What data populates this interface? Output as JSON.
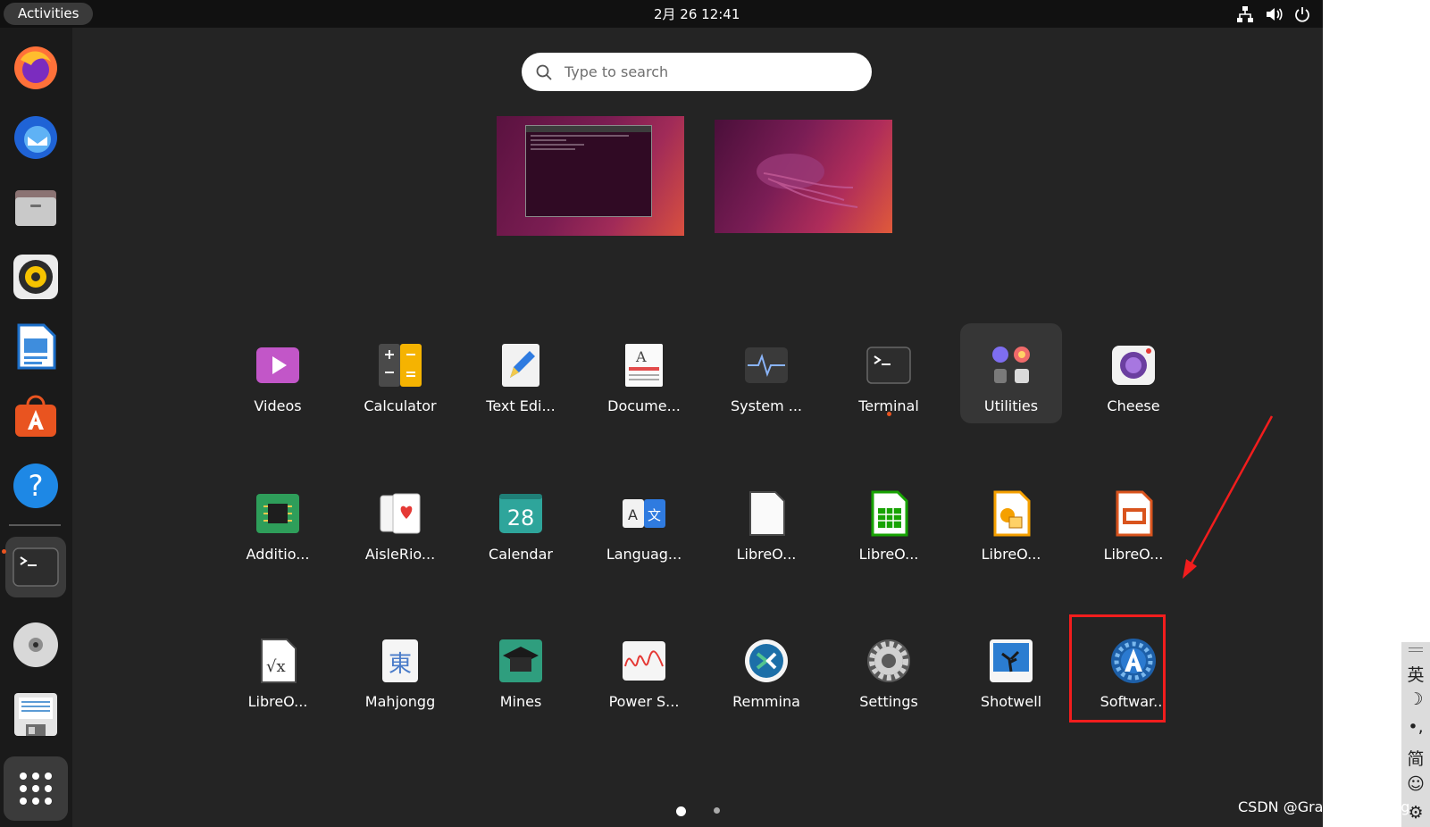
{
  "topbar": {
    "activities_label": "Activities",
    "clock": "2月 26  12:41",
    "tray_icons": [
      "network-icon",
      "volume-icon",
      "power-icon"
    ]
  },
  "dock": {
    "items": [
      {
        "name": "firefox-icon"
      },
      {
        "name": "thunderbird-icon"
      },
      {
        "name": "files-icon"
      },
      {
        "name": "rhythmbox-icon"
      },
      {
        "name": "libreoffice-writer-icon"
      },
      {
        "name": "ubuntu-software-icon"
      },
      {
        "name": "help-icon"
      },
      {
        "name": "terminal-icon",
        "running": true
      },
      {
        "name": "disc-icon"
      },
      {
        "name": "save-floppy-icon"
      },
      {
        "name": "show-apps-icon"
      }
    ]
  },
  "search": {
    "placeholder": "Type to search"
  },
  "apps": [
    {
      "label": "Videos",
      "icon": "videos-icon"
    },
    {
      "label": "Calculator",
      "icon": "calculator-icon"
    },
    {
      "label": "Text Edi...",
      "icon": "text-editor-icon"
    },
    {
      "label": "Docume...",
      "icon": "document-viewer-icon"
    },
    {
      "label": "System ...",
      "icon": "system-monitor-icon"
    },
    {
      "label": "Terminal",
      "icon": "terminal-icon",
      "running": true
    },
    {
      "label": "Utilities",
      "icon": "utilities-folder-icon",
      "selected": true
    },
    {
      "label": "Cheese",
      "icon": "cheese-icon"
    },
    {
      "label": "Additio...",
      "icon": "additional-drivers-icon"
    },
    {
      "label": "AisleRio...",
      "icon": "aisleriot-icon"
    },
    {
      "label": "Calendar",
      "icon": "calendar-icon",
      "day": "28"
    },
    {
      "label": "Languag...",
      "icon": "language-support-icon"
    },
    {
      "label": "LibreO...",
      "icon": "libreoffice-icon"
    },
    {
      "label": "LibreO...",
      "icon": "libreoffice-calc-icon"
    },
    {
      "label": "LibreO...",
      "icon": "libreoffice-draw-icon"
    },
    {
      "label": "LibreO...",
      "icon": "libreoffice-impress-icon"
    },
    {
      "label": "LibreO...",
      "icon": "libreoffice-math-icon"
    },
    {
      "label": "Mahjongg",
      "icon": "mahjongg-icon",
      "glyph": "東"
    },
    {
      "label": "Mines",
      "icon": "mines-icon"
    },
    {
      "label": "Power S...",
      "icon": "power-statistics-icon"
    },
    {
      "label": "Remmina",
      "icon": "remmina-icon"
    },
    {
      "label": "Settings",
      "icon": "settings-gear-icon"
    },
    {
      "label": "Shotwell",
      "icon": "shotwell-icon"
    },
    {
      "label": "Softwar...",
      "icon": "software-icon",
      "highlighted": true
    }
  ],
  "pagination": {
    "pages": 2,
    "current": 1
  },
  "ime_panel": {
    "items": [
      "英",
      "☽",
      "•,",
      "简",
      "☺",
      "⚙"
    ]
  },
  "watermark": "CSDN @Grayson_Zheng",
  "colors": {
    "overview_bg": "#242424",
    "accent_orange": "#e95420",
    "highlight_red": "#f21d1d"
  }
}
